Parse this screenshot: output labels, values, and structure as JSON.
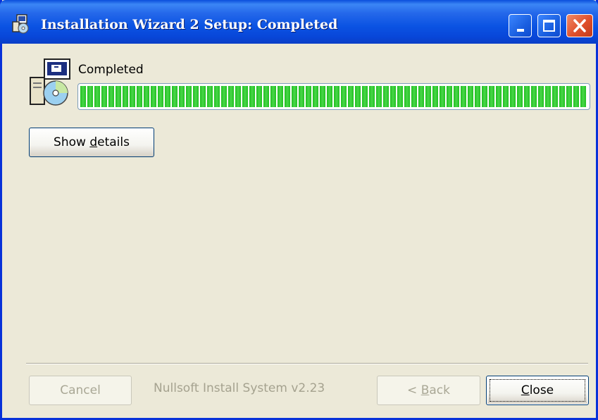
{
  "window": {
    "title": "Installation Wizard 2 Setup: Completed"
  },
  "icons": {
    "app": "installer-app-icon",
    "setup": "setup-computer-cd-icon",
    "minimize": "minimize-icon",
    "maximize": "maximize-icon",
    "close": "close-icon"
  },
  "main": {
    "status": "Completed",
    "progress_percent": 100,
    "show_details": {
      "before": "Show ",
      "key": "d",
      "after": "etails"
    }
  },
  "footer": {
    "branding": "Nullsoft Install System v2.23",
    "cancel": "Cancel",
    "back": {
      "before": "< ",
      "key": "B",
      "after": "ack"
    },
    "close": {
      "before": "",
      "key": "C",
      "after": "lose"
    }
  },
  "colors": {
    "titlebar": "#0a4edc",
    "progress_fill": "#20c020",
    "close_button": "#e0502c",
    "face": "#ece9d8"
  }
}
